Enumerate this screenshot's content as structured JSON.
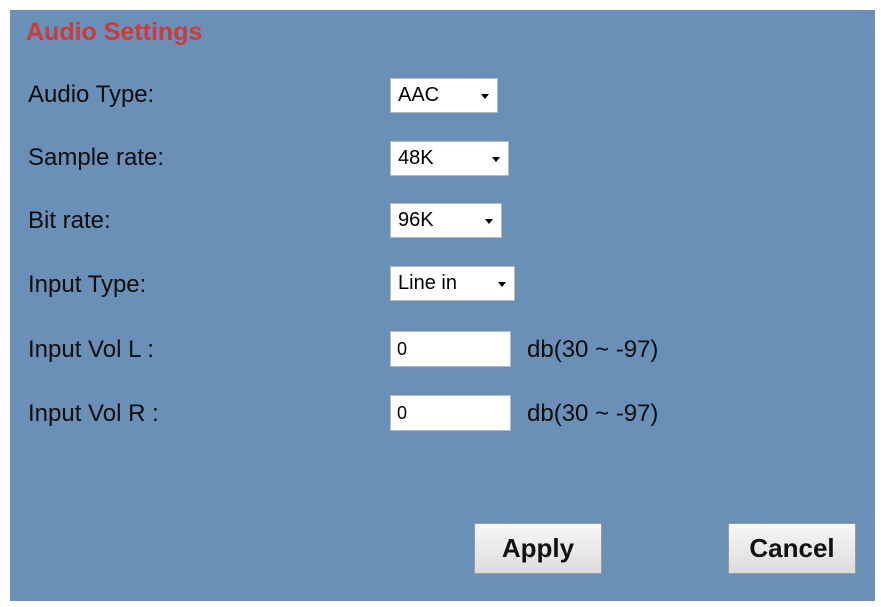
{
  "title": "Audio Settings",
  "fields": {
    "audio_type": {
      "label": "Audio Type:",
      "value": "AAC"
    },
    "sample_rate": {
      "label": "Sample rate:",
      "value": "48K"
    },
    "bit_rate": {
      "label": "Bit rate:",
      "value": "96K"
    },
    "input_type": {
      "label": "Input Type:",
      "value": "Line in"
    },
    "input_vol_l": {
      "label": "Input Vol L :",
      "value": "0",
      "unit": "db(30 ~ -97)"
    },
    "input_vol_r": {
      "label": "Input Vol R :",
      "value": "0",
      "unit": "db(30 ~ -97)"
    }
  },
  "buttons": {
    "apply": "Apply",
    "cancel": "Cancel"
  },
  "colors": {
    "panel_bg": "#6a90b8",
    "title": "#cc3a3a"
  }
}
